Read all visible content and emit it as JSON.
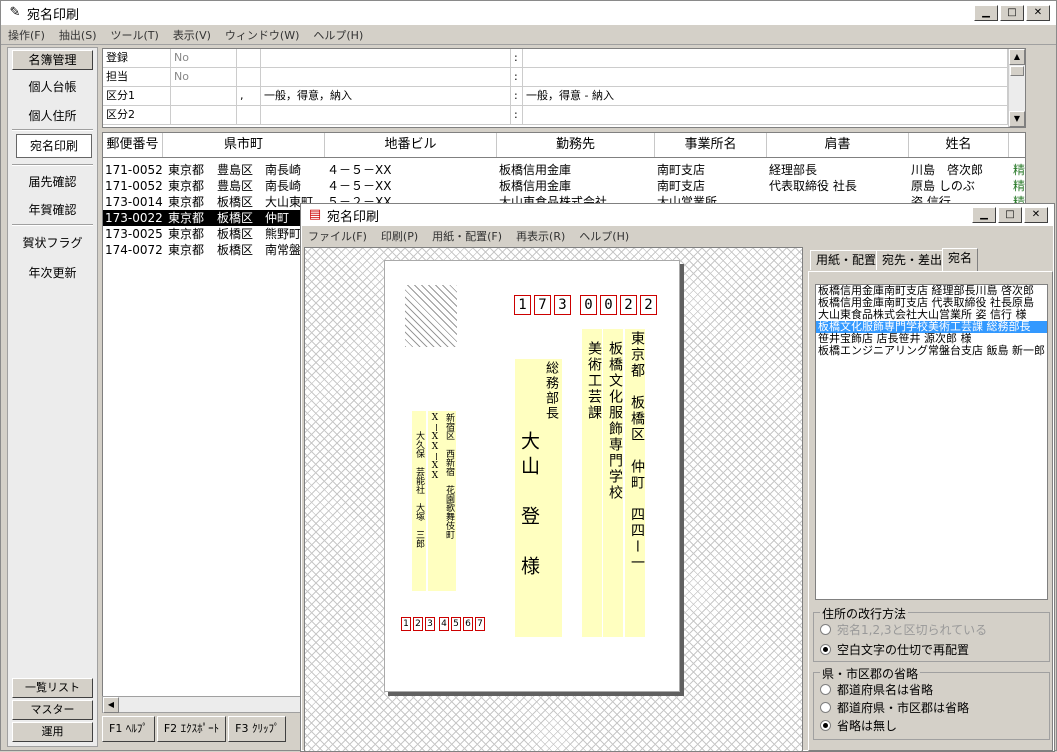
{
  "main": {
    "title": "宛名印刷",
    "menu": [
      "操作(F)",
      "抽出(S)",
      "ツール(T)",
      "表示(V)",
      "ウィンドウ(W)",
      "ヘルプ(H)"
    ],
    "window_buttons": [
      "▁",
      "□",
      "✕"
    ]
  },
  "leftnav": {
    "top_button": "名簿管理",
    "items": [
      "個人台帳",
      "個人住所",
      "宛名印刷",
      "届先確認",
      "年賀確認",
      "賀状フラグ",
      "年次更新"
    ],
    "bottom_buttons": [
      "一覧リスト",
      "マスター",
      "運用"
    ]
  },
  "propgrid": {
    "rows": [
      {
        "label": "登録",
        "v1": "No",
        "v2": "",
        "v3": ":",
        "v4": ""
      },
      {
        "label": "担当",
        "v1": "No",
        "v2": "",
        "v3": "",
        "v4": ""
      },
      {
        "label": "区分1",
        "v1": "",
        "v2": ",",
        "v3": "一般，得意，納入",
        "v4": "一般，得意 - 納入"
      },
      {
        "label": "区分2",
        "v1": "",
        "v2": "",
        "v3": ":",
        "v4": ""
      }
    ],
    "colons": [
      ":",
      ":",
      ":",
      ":"
    ]
  },
  "table": {
    "headers": [
      "郵便番号",
      "県市町",
      "地番ビル",
      "勤務先",
      "事業所名",
      "肩書",
      "姓名"
    ],
    "rows": [
      {
        "zip": "171-0052",
        "pref": "東京都",
        "ward": "豊島区",
        "town": "南長崎",
        "addr": "４－５－XX",
        "company": "板橋信用金庫",
        "office": "南町支店",
        "title": "経理部長",
        "name": "川島　啓次郎",
        "extra": "精"
      },
      {
        "zip": "171-0052",
        "pref": "東京都",
        "ward": "豊島区",
        "town": "南長崎",
        "addr": "４－５－XX",
        "company": "板橋信用金庫",
        "office": "南町支店",
        "title": "代表取締役 社長",
        "name": "原島 しのぶ",
        "extra": "精"
      },
      {
        "zip": "173-0014",
        "pref": "東京都",
        "ward": "板橋区",
        "town": "大山東町",
        "addr": "５－２－XX",
        "company": "大山東食品株式会社",
        "office": "大山営業所",
        "title": "",
        "name": "姿 信行",
        "extra": "精"
      },
      {
        "zip": "173-0022",
        "pref": "東京都",
        "ward": "板橋区",
        "town": "仲町",
        "addr": "",
        "company": "",
        "office": "",
        "title": "",
        "name": "",
        "extra": ""
      },
      {
        "zip": "173-0025",
        "pref": "東京都",
        "ward": "板橋区",
        "town": "熊野町",
        "addr": "",
        "company": "",
        "office": "",
        "title": "",
        "name": "",
        "extra": ""
      },
      {
        "zip": "174-0072",
        "pref": "東京都",
        "ward": "板橋区",
        "town": "南常盤台",
        "addr": "",
        "company": "",
        "office": "",
        "title": "",
        "name": "",
        "extra": ""
      }
    ],
    "selected_index": 3
  },
  "fkeys": [
    "F1 ﾍﾙﾌﾟ",
    "F2 ｴｸｽﾎﾟｰﾄ",
    "F3 ｸﾘｯﾌﾟ"
  ],
  "sub": {
    "title": "宛名印刷",
    "menu": [
      "ファイル(F)",
      "印刷(P)",
      "用紙・配置(F)",
      "再表示(R)",
      "ヘルプ(H)"
    ],
    "window_buttons": [
      "▁",
      "□",
      "✕"
    ],
    "postcard": {
      "zip": [
        "1",
        "7",
        "3",
        "0",
        "0",
        "2",
        "2"
      ],
      "address1": "東京都　板橋区　仲町　四四ー一",
      "company": "板橋文化服飾専門学校",
      "dept": "美術工芸課",
      "position": "総務部長",
      "recipient": "大山　登　様",
      "sender_address": "新宿区　西新宿　花園歌舞伎町",
      "sender_code": "XーXXーXX",
      "sender_name": "大久保　芸能社　大塚　三郎",
      "sender_zip": [
        "1",
        "2",
        "3",
        "4",
        "5",
        "6",
        "7"
      ]
    },
    "tabs": [
      "用紙・配置",
      "宛先・差出",
      "宛名"
    ],
    "list": [
      "板橋信用金庫南町支店 経理部長川島 啓次郎",
      "板橋信用金庫南町支店 代表取締役 社長原島",
      "大山東食品株式会社大山営業所 姿 信行 様",
      "板橋文化服飾専門学校美術工芸課 総務部長",
      "笹井宝飾店 店長笹井 源次郎 様",
      "板橋エンジニアリング常盤台支店 飯島 新一郎"
    ],
    "list_selected": 3,
    "group1": {
      "title": "住所の改行方法",
      "options": [
        "宛名1,2,3と区切られている",
        "空白文字の仕切で再配置"
      ],
      "selected": 1
    },
    "group2": {
      "title": "県・市区郡の省略",
      "options": [
        "都道府県名は省略",
        "都道府県・市区郡は省略",
        "省略は無し"
      ],
      "selected": 2
    }
  }
}
